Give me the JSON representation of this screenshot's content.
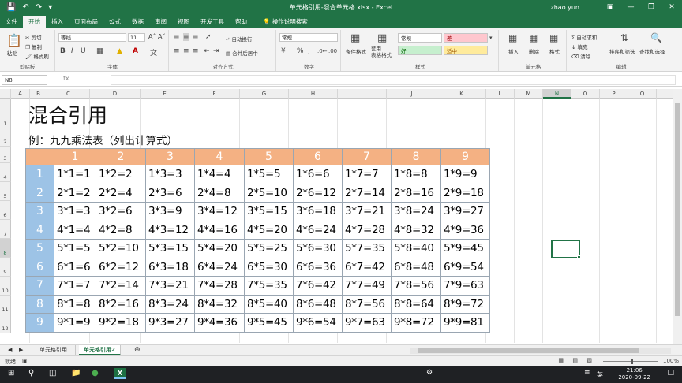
{
  "window": {
    "title": "单元格引用-混合单元格.xlsx - Excel",
    "user": "zhao yun",
    "minimize_icon": "minimize-icon",
    "maximize_icon": "maximize-icon",
    "close_icon": "close-icon"
  },
  "tabs": [
    "文件",
    "开始",
    "插入",
    "页面布局",
    "公式",
    "数据",
    "审阅",
    "视图",
    "开发工具",
    "帮助"
  ],
  "active_tab": "开始",
  "tell_me": "操作说明搜索",
  "ribbon": {
    "clipboard": {
      "paste": "粘贴",
      "cut": "剪切",
      "copy": "复制",
      "format_painter": "格式刷",
      "label": "剪贴板"
    },
    "font": {
      "name": "等线",
      "size": "11",
      "bold": "B",
      "italic": "I",
      "underline": "U",
      "label": "字体"
    },
    "alignment": {
      "wrap": "自动换行",
      "merge": "合并后居中",
      "label": "对齐方式"
    },
    "number": {
      "format": "常规",
      "percent": "%",
      "comma": ",",
      "label": "数字"
    },
    "styles": {
      "conditional": "条件格式",
      "table": "套用\n表格格式",
      "normal": "常规",
      "bad": "差",
      "good": "好",
      "neutral": "适中",
      "label": "样式"
    },
    "cells": {
      "insert": "插入",
      "delete": "删除",
      "format": "格式",
      "label": "单元格"
    },
    "editing": {
      "autosum": "自动求和",
      "fill": "填充",
      "clear": "清除",
      "sort": "排序和筛选",
      "find": "查找和选择",
      "label": "编辑"
    }
  },
  "formula_bar": {
    "name_box": "N8",
    "fx": "fx",
    "value": ""
  },
  "columns": [
    "A",
    "B",
    "C",
    "D",
    "E",
    "F",
    "G",
    "H",
    "I",
    "J",
    "K",
    "L",
    "M",
    "N",
    "O",
    "P",
    "Q"
  ],
  "selected_column": "N",
  "rows": [
    "1",
    "2",
    "3",
    "4",
    "5",
    "6",
    "7",
    "8",
    "9",
    "10",
    "11",
    "12"
  ],
  "selected_row": "8",
  "sheet": {
    "title": "混合引用",
    "subtitle": "例：九九乘法表（列出计算式）",
    "header_cols": [
      "1",
      "2",
      "3",
      "4",
      "5",
      "6",
      "7",
      "8",
      "9"
    ],
    "header_rows": [
      "1",
      "2",
      "3",
      "4",
      "5",
      "6",
      "7",
      "8",
      "9"
    ],
    "cells": [
      [
        "1*1=1",
        "1*2=2",
        "1*3=3",
        "1*4=4",
        "1*5=5",
        "1*6=6",
        "1*7=7",
        "1*8=8",
        "1*9=9"
      ],
      [
        "2*1=2",
        "2*2=4",
        "2*3=6",
        "2*4=8",
        "2*5=10",
        "2*6=12",
        "2*7=14",
        "2*8=16",
        "2*9=18"
      ],
      [
        "3*1=3",
        "3*2=6",
        "3*3=9",
        "3*4=12",
        "3*5=15",
        "3*6=18",
        "3*7=21",
        "3*8=24",
        "3*9=27"
      ],
      [
        "4*1=4",
        "4*2=8",
        "4*3=12",
        "4*4=16",
        "4*5=20",
        "4*6=24",
        "4*7=28",
        "4*8=32",
        "4*9=36"
      ],
      [
        "5*1=5",
        "5*2=10",
        "5*3=15",
        "5*4=20",
        "5*5=25",
        "5*6=30",
        "5*7=35",
        "5*8=40",
        "5*9=45"
      ],
      [
        "6*1=6",
        "6*2=12",
        "6*3=18",
        "6*4=24",
        "6*5=30",
        "6*6=36",
        "6*7=42",
        "6*8=48",
        "6*9=54"
      ],
      [
        "7*1=7",
        "7*2=14",
        "7*3=21",
        "7*4=28",
        "7*5=35",
        "7*6=42",
        "7*7=49",
        "7*8=56",
        "7*9=63"
      ],
      [
        "8*1=8",
        "8*2=16",
        "8*3=24",
        "8*4=32",
        "8*5=40",
        "8*6=48",
        "8*7=56",
        "8*8=64",
        "8*9=72"
      ],
      [
        "9*1=9",
        "9*2=18",
        "9*3=27",
        "9*4=36",
        "9*5=45",
        "9*6=54",
        "9*7=63",
        "9*8=72",
        "9*9=81"
      ]
    ]
  },
  "sheet_tabs": [
    "单元格引用1",
    "单元格引用2"
  ],
  "active_sheet": "单元格引用2",
  "status": {
    "ready": "就绪",
    "zoom": "100%"
  },
  "taskbar": {
    "time": "21:06",
    "date": "2020-09-22",
    "ime": "英"
  },
  "colors": {
    "excel_green": "#217346",
    "header_orange": "#f4b183",
    "header_blue": "#9dc3e6"
  }
}
